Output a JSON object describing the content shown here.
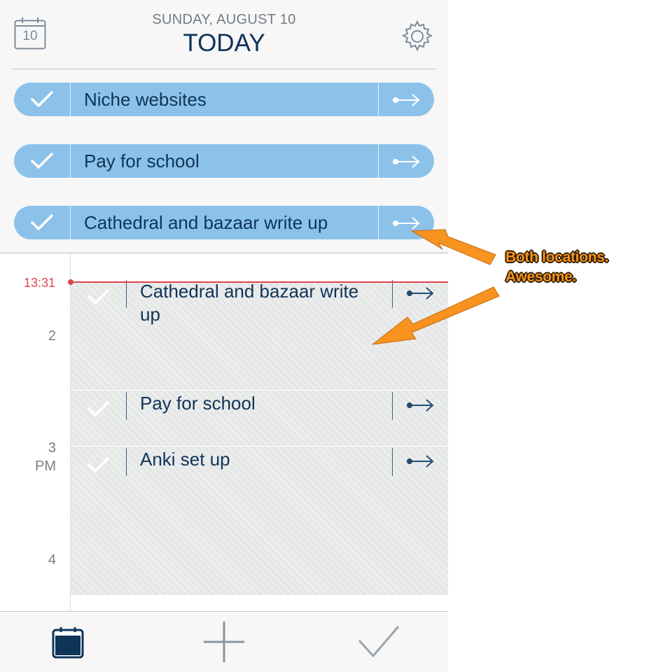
{
  "header": {
    "date_line": "SUNDAY, AUGUST 10",
    "title": "TODAY",
    "calendar_day": "10"
  },
  "tasks": [
    {
      "label": "Niche websites"
    },
    {
      "label": "Pay for school"
    },
    {
      "label": "Cathedral and bazaar write up"
    }
  ],
  "timeline": {
    "now_label": "13:31",
    "hours": [
      "2",
      "3",
      "PM",
      "4"
    ],
    "events": [
      {
        "label": "Cathedral and bazaar write up"
      },
      {
        "label": "Pay for school"
      },
      {
        "label": "Anki set up"
      }
    ]
  },
  "annotation": {
    "line1": "Both locations.",
    "line2": "Awesome."
  },
  "colors": {
    "pill": "#8cc2ea",
    "navy": "#0e3458",
    "now_red": "#e0454d",
    "annotation_orange": "#f7931e"
  },
  "icons": {
    "header_left": "calendar-icon",
    "header_right": "gear-icon",
    "row_check": "checkmark-icon",
    "row_defer": "defer-arrow-icon",
    "tab_calendar": "calendar-tab-icon",
    "tab_add": "plus-icon",
    "tab_done": "checkmark-icon"
  }
}
